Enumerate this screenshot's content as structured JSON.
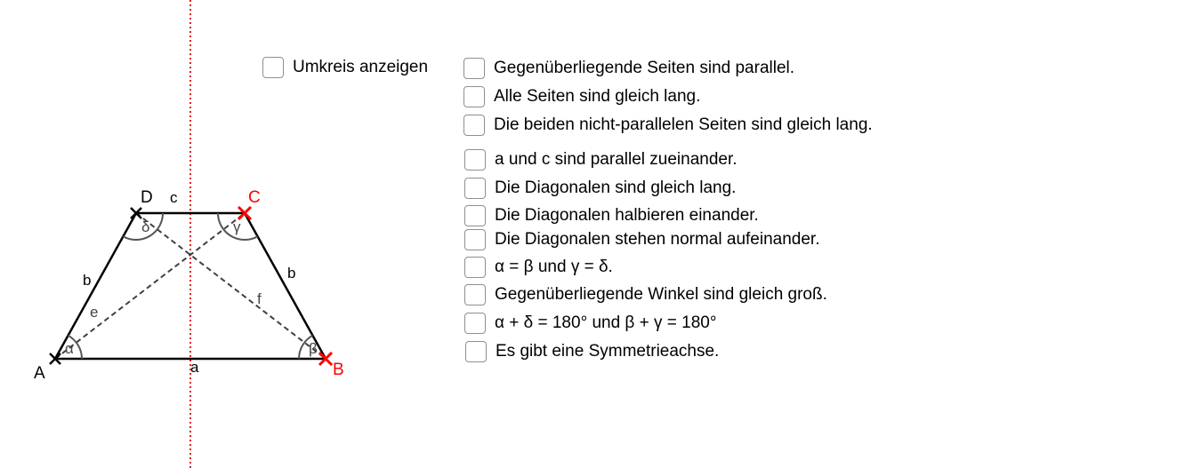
{
  "construction": {
    "points": {
      "A": "A",
      "B": "B",
      "C": "C",
      "D": "D"
    },
    "sides": {
      "a": "a",
      "b_left": "b",
      "b_right": "b",
      "c": "c"
    },
    "diagonals": {
      "e": "e",
      "f": "f"
    },
    "angles": {
      "alpha": "α",
      "beta": "β",
      "gamma": "γ",
      "delta": "δ"
    },
    "colors": {
      "free_point": "#ff0000",
      "fixed_point": "#000000",
      "axis": "#e02020",
      "diagonal": "#404040",
      "angle_arc": "#555555"
    }
  },
  "options": {
    "circumcircle_label": "Umkreis anzeigen",
    "circumcircle_checked": false
  },
  "properties": [
    {
      "label": "Gegenüberliegende Seiten sind parallel.",
      "checked": false
    },
    {
      "label": "Alle Seiten sind gleich lang.",
      "checked": false
    },
    {
      "label": "Die beiden nicht-parallelen Seiten sind gleich lang.",
      "checked": false
    },
    {
      "label": "a und c sind parallel zueinander.",
      "checked": false
    },
    {
      "label": "Die Diagonalen sind gleich lang.",
      "checked": false
    },
    {
      "label": "Die Diagonalen halbieren einander.",
      "checked": false
    },
    {
      "label": "Die Diagonalen stehen normal aufeinander.",
      "checked": false
    },
    {
      "label": "α = β und γ = δ.",
      "checked": false
    },
    {
      "label": "Gegenüberliegende Winkel sind gleich groß.",
      "checked": false
    },
    {
      "label": "α + δ = 180° und β + γ = 180°",
      "checked": false
    },
    {
      "label": "Es gibt eine Symmetrieachse.",
      "checked": false
    }
  ]
}
